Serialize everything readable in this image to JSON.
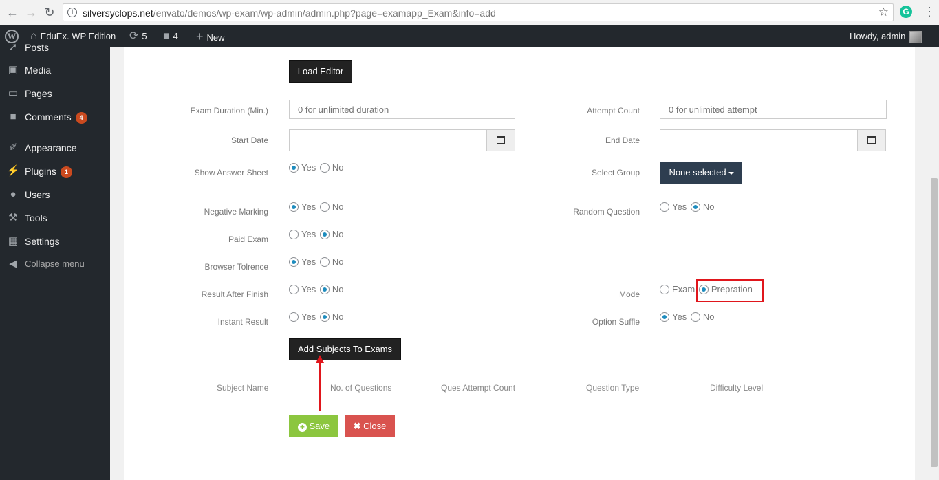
{
  "browser": {
    "url_host": "silversyclops.net",
    "url_path": "/envato/demos/wp-exam/wp-admin/admin.php?page=examapp_Exam&info=add"
  },
  "adminbar": {
    "site_name": "EduEx. WP Edition",
    "updates_count": "5",
    "comments_count": "4",
    "new_label": "New",
    "howdy": "Howdy, admin"
  },
  "sidebar": {
    "items": [
      {
        "label": "Posts",
        "icon": "pin-icon"
      },
      {
        "label": "Media",
        "icon": "media-icon"
      },
      {
        "label": "Pages",
        "icon": "pages-icon"
      },
      {
        "label": "Comments",
        "icon": "comments-icon",
        "badge": "4"
      },
      {
        "label": "Appearance",
        "icon": "brush-icon"
      },
      {
        "label": "Plugins",
        "icon": "plug-icon",
        "badge": "1"
      },
      {
        "label": "Users",
        "icon": "user-icon"
      },
      {
        "label": "Tools",
        "icon": "wrench-icon"
      },
      {
        "label": "Settings",
        "icon": "settings-icon"
      },
      {
        "label": "Collapse menu",
        "icon": "collapse-icon"
      }
    ]
  },
  "form": {
    "load_editor": "Load Editor",
    "exam_duration_label": "Exam Duration (Min.)",
    "exam_duration_placeholder": "0 for unlimited duration",
    "attempt_count_label": "Attempt Count",
    "attempt_count_placeholder": "0 for unlimited attempt",
    "start_date_label": "Start Date",
    "end_date_label": "End Date",
    "show_answer_sheet_label": "Show Answer Sheet",
    "select_group_label": "Select Group",
    "select_group_value": "None selected",
    "negative_marking_label": "Negative Marking",
    "random_question_label": "Random Question",
    "paid_exam_label": "Paid Exam",
    "browser_tolrence_label": "Browser Tolrence",
    "result_after_finish_label": "Result After Finish",
    "mode_label": "Mode",
    "instant_result_label": "Instant Result",
    "option_suffle_label": "Option Suffle",
    "yes": "Yes",
    "no": "No",
    "exam": "Exam",
    "prepration": "Prepration",
    "add_subjects": "Add Subjects To Exams",
    "save": "Save",
    "close": "Close"
  },
  "subjects_table": {
    "headers": [
      "Subject Name",
      "No. of Questions",
      "Ques Attempt Count",
      "Question Type",
      "Difficulty Level"
    ]
  },
  "radio_state": {
    "show_answer_sheet": "Yes",
    "negative_marking": "Yes",
    "random_question": "No",
    "paid_exam": "No",
    "browser_tolrence": "Yes",
    "result_after_finish": "No",
    "mode": "Prepration",
    "instant_result": "No",
    "option_suffle": "Yes"
  },
  "colors": {
    "accent_radio": "#1e8cbe",
    "save_green": "#8cc63f",
    "close_red": "#d9534f",
    "annotation_red": "#e0161c",
    "sidebar_bg": "#23282d"
  }
}
